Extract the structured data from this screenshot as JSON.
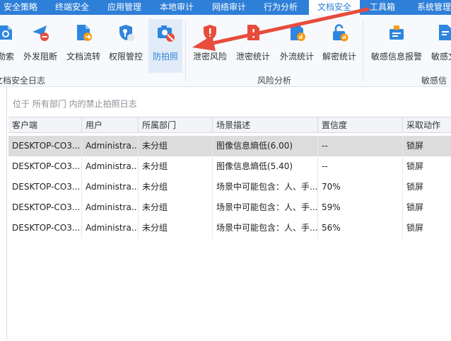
{
  "menubar": {
    "items": [
      {
        "label": "安全策略"
      },
      {
        "label": "终端安全"
      },
      {
        "label": "应用管理"
      },
      {
        "label": "本地审计"
      },
      {
        "label": "网络审计"
      },
      {
        "label": "行为分析"
      },
      {
        "label": "文档安全",
        "active": true
      },
      {
        "label": "工具箱"
      },
      {
        "label": "系统管理"
      }
    ]
  },
  "ribbon": {
    "groups": [
      {
        "label": "文档安全日志",
        "buttons": [
          {
            "label": "勒索",
            "icon": "shield-doc-icon"
          },
          {
            "label": "外发阻断",
            "icon": "send-blocked-icon"
          },
          {
            "label": "文档流转",
            "icon": "document-flow-icon"
          },
          {
            "label": "权限管控",
            "icon": "shield-key-icon"
          },
          {
            "label": "防拍照",
            "icon": "camera-blocked-icon",
            "active": true
          }
        ]
      },
      {
        "label": "风险分析",
        "buttons": [
          {
            "label": "泄密风险",
            "icon": "shield-alert-icon"
          },
          {
            "label": "泄密统计",
            "icon": "document-alert-icon"
          },
          {
            "label": "外流统计",
            "icon": "outflow-stats-icon"
          },
          {
            "label": "解密统计",
            "icon": "unlock-stats-icon"
          }
        ]
      },
      {
        "label": "敏感信",
        "buttons": [
          {
            "label": "敏感信息报警",
            "icon": "sensitive-alarm-icon"
          },
          {
            "label": "敏感文",
            "icon": "sensitive-doc-icon"
          }
        ]
      }
    ]
  },
  "breadcrumb": "位于 所有部门 内的禁止拍照日志",
  "table": {
    "columns": [
      "客户端",
      "用户",
      "所属部门",
      "场景描述",
      "置信度",
      "采取动作"
    ],
    "rows": [
      {
        "selected": true,
        "cells": [
          "DESKTOP-CO3...",
          "Administra...",
          "未分组",
          "图像信息熵低(6.00)",
          "--",
          "锁屏"
        ]
      },
      {
        "cells": [
          "DESKTOP-CO3...",
          "Administra...",
          "未分组",
          "图像信息熵低(5.40)",
          "--",
          "锁屏"
        ]
      },
      {
        "cells": [
          "DESKTOP-CO3...",
          "Administra...",
          "未分组",
          "场景中可能包含：人、手...",
          "70%",
          "锁屏"
        ]
      },
      {
        "cells": [
          "DESKTOP-CO3...",
          "Administra...",
          "未分组",
          "场景中可能包含：人、手...",
          "59%",
          "锁屏"
        ]
      },
      {
        "cells": [
          "DESKTOP-CO3...",
          "Administra...",
          "未分组",
          "场景中可能包含：人、手...",
          "56%",
          "锁屏"
        ]
      }
    ]
  },
  "colors": {
    "menubar": "#2e7fd8",
    "icon_blue": "#2e86de",
    "icon_red": "#e74c3c",
    "icon_orange": "#f39c12",
    "arrow": "#e74c3c",
    "selected_row": "#dcdcdc"
  }
}
